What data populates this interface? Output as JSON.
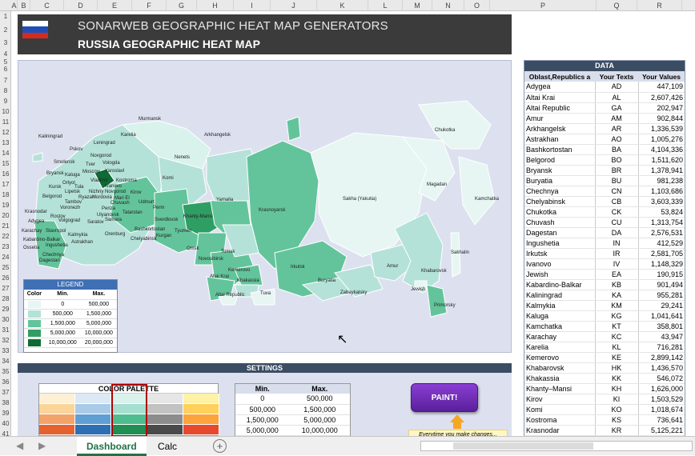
{
  "columns": [
    "A",
    "B",
    "C",
    "D",
    "E",
    "F",
    "G",
    "H",
    "I",
    "J",
    "K",
    "L",
    "M",
    "N",
    "O",
    "P",
    "Q",
    "R"
  ],
  "rows": [
    "1",
    "2",
    "3",
    "4",
    "5",
    "6",
    "7",
    "8",
    "9",
    "10",
    "11",
    "12",
    "13",
    "14",
    "15",
    "16",
    "17",
    "18",
    "19",
    "20",
    "21",
    "22",
    "23",
    "24",
    "25",
    "26",
    "27",
    "28",
    "29",
    "30",
    "31",
    "32",
    "33",
    "34",
    "35",
    "36",
    "37",
    "38",
    "39",
    "40",
    "41"
  ],
  "header": {
    "title": "SONARWEB GEOGRAPHIC HEAT MAP GENERATORS",
    "subtitle": "RUSSIA GEOGRAPHIC HEAT MAP",
    "flag_colors": [
      "#ffffff",
      "#1f4fb6",
      "#d52b1e"
    ]
  },
  "map_labels": [
    "Murmansk",
    "Karelia",
    "Kaliningrad",
    "Leningrad",
    "Pskov",
    "Novgorod",
    "Arkhangelsk",
    "Nenets",
    "Chukotka",
    "Smolensk",
    "Tver",
    "Vologda",
    "Bryansk",
    "Kaluga",
    "Moscow",
    "Yaroslavl",
    "Komi",
    "Orlyol",
    "Vladimir",
    "Kostroma",
    "Kursk",
    "Tula",
    "Ivanovo",
    "Lipetsk",
    "Nizhny Novgorod",
    "Kirov",
    "Belgorod",
    "Ryazan",
    "Mordovia",
    "Mari El",
    "Tambov",
    "Chuvash",
    "Udmurt",
    "Krasnodar",
    "Voronezh",
    "Penza",
    "Tatarstan",
    "Perm",
    "Yamalia",
    "Sakha (Yakutia)",
    "Magadan",
    "Kamchatka",
    "Adygea",
    "Rostov",
    "Ulyanovsk",
    "Sverdlovsk",
    "Khanty-Mansi",
    "Krasnoyarsk",
    "Karachay",
    "Volgograd",
    "Saratov",
    "Samara",
    "Bashkortostan",
    "Kalmykia",
    "Orenburg",
    "Chelyabinsk",
    "Tyumen",
    "Kabardino-Balkar",
    "Stavropol",
    "Astrakhan",
    "Kurgan",
    "Omsk",
    "Ossetia",
    "Ingushetia",
    "Tomsk",
    "Chechnya",
    "Dagestan",
    "Novosibirsk",
    "Kemerovo",
    "Irkutsk",
    "Amur",
    "Sakhalin",
    "Khabarovsk",
    "Altai Krai",
    "Khakassia",
    "Buryatia",
    "Altai Republic",
    "Tuva",
    "Zabaykalsky",
    "Jewish",
    "Primorsky"
  ],
  "legend": {
    "title": "LEGEND",
    "headers": [
      "Color",
      "Min.",
      "Max."
    ],
    "rows": [
      {
        "color": "#e7f6f3",
        "min": "0",
        "max": "500,000"
      },
      {
        "color": "#b4e2d8",
        "min": "500,000",
        "max": "1,500,000"
      },
      {
        "color": "#63c49b",
        "min": "1,500,000",
        "max": "5,000,000"
      },
      {
        "color": "#2f9e63",
        "min": "5,000,000",
        "max": "10,000,000"
      },
      {
        "color": "#0d6b35",
        "min": "10,000,000",
        "max": "20,000,000"
      }
    ]
  },
  "settings": {
    "title": "SETTINGS",
    "palette_title": "COLOR PALETTE",
    "palette_columns": [
      [
        "#fdf0d5",
        "#fbd49a",
        "#f3a36a",
        "#e5622f"
      ],
      [
        "#dbe9f5",
        "#a9cbe8",
        "#5f9fd4",
        "#2c6fb5"
      ],
      [
        "#d9f2ec",
        "#a6dfcf",
        "#4ebc8e",
        "#1f8f52"
      ],
      [
        "#e6e6e6",
        "#c2c2c2",
        "#8c8c8c",
        "#4a4a4a"
      ],
      [
        "#fff2a8",
        "#ffd15c",
        "#fca33b",
        "#e6492b"
      ]
    ],
    "minmax_headers": [
      "Min.",
      "Max."
    ],
    "minmax_rows": [
      [
        "0",
        "500,000"
      ],
      [
        "500,000",
        "1,500,000"
      ],
      [
        "1,500,000",
        "5,000,000"
      ],
      [
        "5,000,000",
        "10,000,000"
      ]
    ],
    "paint_label": "PAINT!",
    "note": "Everytime you make changes..."
  },
  "data_table": {
    "title": "DATA",
    "headers": [
      "Oblast,Republics a",
      "Your Texts",
      "Your Values"
    ],
    "rows": [
      [
        "Adygea",
        "AD",
        "447,109"
      ],
      [
        "Altai Krai",
        "AL",
        "2,607,426"
      ],
      [
        "Altai Republic",
        "GA",
        "202,947"
      ],
      [
        "Amur",
        "AM",
        "902,844"
      ],
      [
        "Arkhangelsk",
        "AR",
        "1,336,539"
      ],
      [
        "Astrakhan",
        "AO",
        "1,005,276"
      ],
      [
        "Bashkortostan",
        "BA",
        "4,104,336"
      ],
      [
        "Belgorod",
        "BO",
        "1,511,620"
      ],
      [
        "Bryansk",
        "BR",
        "1,378,941"
      ],
      [
        "Buryatia",
        "BU",
        "981,238"
      ],
      [
        "Chechnya",
        "CN",
        "1,103,686"
      ],
      [
        "Chelyabinsk",
        "CB",
        "3,603,339"
      ],
      [
        "Chukotka",
        "CK",
        "53,824"
      ],
      [
        "Chuvash",
        "CU",
        "1,313,754"
      ],
      [
        "Dagestan",
        "DA",
        "2,576,531"
      ],
      [
        "Ingushetia",
        "IN",
        "412,529"
      ],
      [
        "Irkutsk",
        "IR",
        "2,581,705"
      ],
      [
        "Ivanovo",
        "IV",
        "1,148,329"
      ],
      [
        "Jewish",
        "EA",
        "190,915"
      ],
      [
        "Kabardino-Balkar",
        "KB",
        "901,494"
      ],
      [
        "Kaliningrad",
        "KA",
        "955,281"
      ],
      [
        "Kalmykia",
        "KM",
        "29,241"
      ],
      [
        "Kaluga",
        "KG",
        "1,041,641"
      ],
      [
        "Kamchatka",
        "KT",
        "358,801"
      ],
      [
        "Karachay",
        "KC",
        "43,947"
      ],
      [
        "Karelia",
        "KL",
        "716,281"
      ],
      [
        "Kemerovo",
        "KE",
        "2,899,142"
      ],
      [
        "Khabarovsk",
        "HK",
        "1,436,570"
      ],
      [
        "Khakassia",
        "KK",
        "546,072"
      ],
      [
        "Khanty–Mansi",
        "KH",
        "1,626,000"
      ],
      [
        "Kirov",
        "KI",
        "1,503,529"
      ],
      [
        "Komi",
        "KO",
        "1,018,674"
      ],
      [
        "Kostroma",
        "KS",
        "736,641"
      ],
      [
        "Krasnodar",
        "KR",
        "5,125,221"
      ]
    ]
  },
  "tabs": [
    "Dashboard",
    "Calc"
  ],
  "active_tab": "Dashboard"
}
